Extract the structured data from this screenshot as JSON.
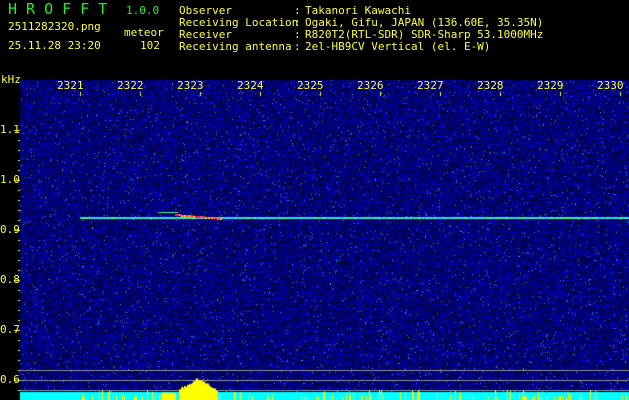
{
  "header": {
    "app_name": "H R O F F T",
    "version": "1.0.0",
    "filename": "2511282320.png",
    "datetime": "25.11.28 23:20",
    "meteor_label": "meteor",
    "meteor_count": "102",
    "info": [
      {
        "label": "Observer",
        "value": "Takanori Kawachi"
      },
      {
        "label": "Receiving Location",
        "value": "Ogaki, Gifu, JAPAN (136.60E, 35.35N)"
      },
      {
        "label": "Receiver",
        "value": "R820T2(RTL-SDR) SDR-Sharp 53.1000MHz"
      },
      {
        "label": "Receiving antenna",
        "value": "2el-HB9CV Vertical (el. E-W)"
      }
    ]
  },
  "spectrogram": {
    "y_unit": "kHz",
    "x_ticks": [
      "2321",
      "2322",
      "2323",
      "2324",
      "2325",
      "2326",
      "2327",
      "2328",
      "2329",
      "2330"
    ],
    "y_ticks": [
      "1.1",
      "1.0",
      "0.9",
      "0.8",
      "0.7",
      "0.6"
    ],
    "carrier_kHz": 0.927,
    "colors": {
      "text": "#ffff33",
      "logo": "#22ee22",
      "noise": "#1010c0",
      "carrier": "#40ff80",
      "echo": "#ff2060",
      "level_base": "#00ffff",
      "level_peak": "#ffff00"
    }
  }
}
